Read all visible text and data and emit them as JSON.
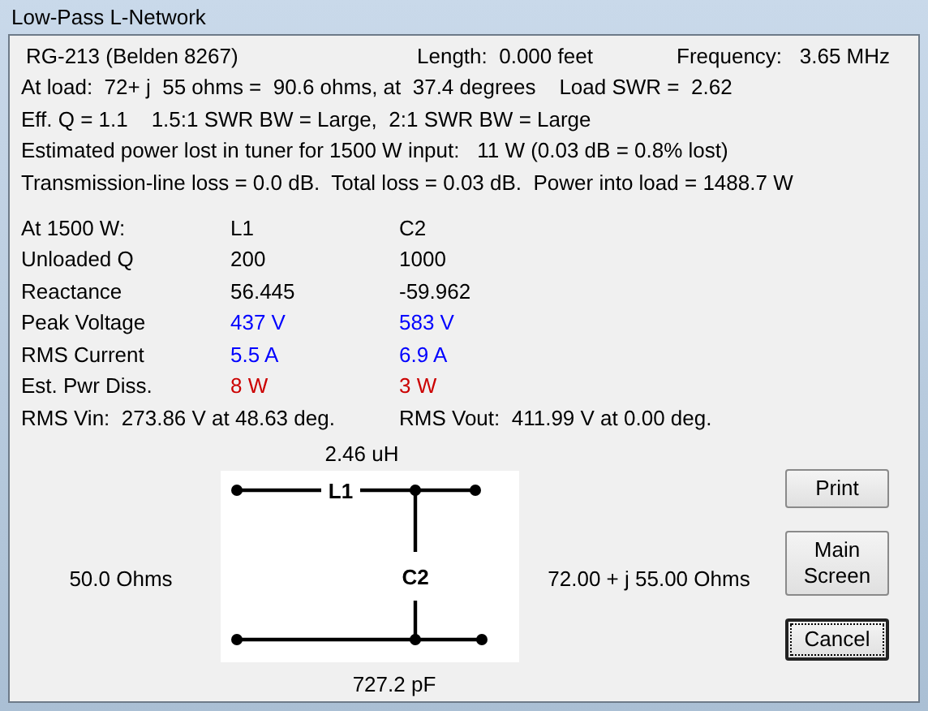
{
  "window": {
    "title": "Low-Pass L-Network"
  },
  "header": {
    "cable": "RG-213 (Belden 8267)",
    "length": "Length:  0.000 feet",
    "frequency": "Frequency:   3.65 MHz"
  },
  "summary_lines": [
    "At load:  72+ j  55 ohms =  90.6 ohms, at  37.4 degrees    Load SWR =  2.62",
    "Eff. Q = 1.1    1.5:1 SWR BW = Large,  2:1 SWR BW = Large",
    "Estimated power lost in tuner for 1500 W input:   11 W (0.03 dB = 0.8% lost)",
    "Transmission-line loss = 0.0 dB.  Total loss = 0.03 dB.  Power into load = 1488.7 W"
  ],
  "table": {
    "columns": [
      "At 1500 W:",
      "L1",
      "C2"
    ],
    "rows": [
      {
        "label": "Unloaded Q",
        "values": [
          "200",
          "1000"
        ],
        "color": "#000000"
      },
      {
        "label": "Reactance",
        "values": [
          "56.445",
          "-59.962"
        ],
        "color": "#000000"
      },
      {
        "label": "Peak Voltage",
        "values": [
          "437 V",
          "583 V"
        ],
        "color": "#0000ff"
      },
      {
        "label": "RMS Current",
        "values": [
          "5.5 A",
          "6.9 A"
        ],
        "color": "#0000ff"
      },
      {
        "label": "Est. Pwr Diss.",
        "values": [
          "8 W",
          "3 W"
        ],
        "color": "#cc0000"
      }
    ]
  },
  "rms": [
    "RMS Vin:  273.86 V at 48.63 deg.",
    "RMS Vout:  411.99 V at 0.00 deg."
  ],
  "circuit": {
    "inductance": "2.46 uH",
    "capacitance": "727.2 pF",
    "source": "50.0 Ohms",
    "load": "72.00 + j 55.00 Ohms",
    "inductor_label": "L1",
    "capacitor_label": "C2"
  },
  "buttons": [
    {
      "label": "Print",
      "focused": false
    },
    {
      "label": "Main Screen",
      "focused": false
    },
    {
      "label": "Cancel",
      "focused": true
    }
  ]
}
